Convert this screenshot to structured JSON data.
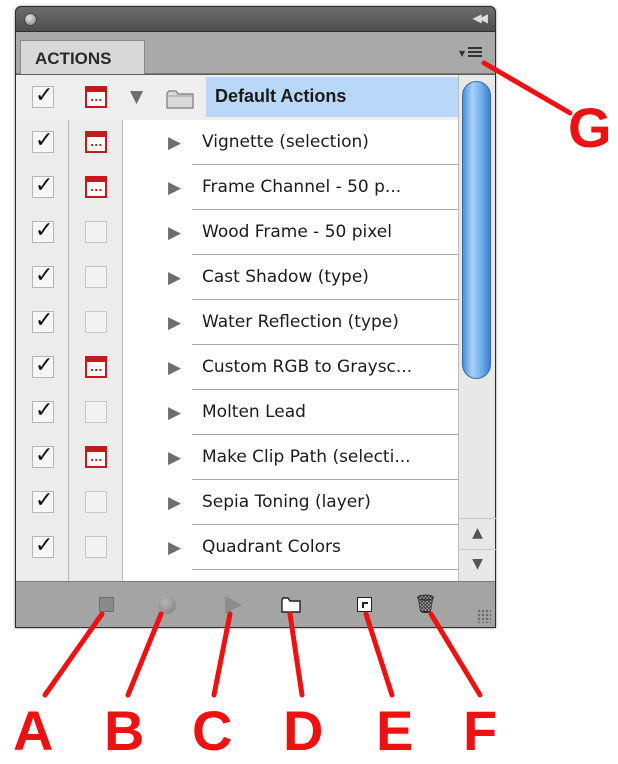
{
  "panel": {
    "tab_label": "ACTIONS",
    "icons": {
      "window_control": "circle-button-icon",
      "collapse": "double-chevron-left-icon",
      "panel_menu": "panel-menu-icon"
    }
  },
  "actions_list": {
    "set": {
      "name": "Default Actions",
      "checked": true,
      "dialog": true,
      "expanded": true,
      "selected": true
    },
    "items": [
      {
        "name": "Vignette (selection)",
        "checked": true,
        "dialog": true
      },
      {
        "name": "Frame Channel - 50 p...",
        "checked": true,
        "dialog": true
      },
      {
        "name": "Wood Frame - 50 pixel",
        "checked": true,
        "dialog": false
      },
      {
        "name": "Cast Shadow (type)",
        "checked": true,
        "dialog": false
      },
      {
        "name": "Water Reflection (type)",
        "checked": true,
        "dialog": false
      },
      {
        "name": "Custom RGB to Graysc...",
        "checked": true,
        "dialog": true
      },
      {
        "name": "Molten Lead",
        "checked": true,
        "dialog": false
      },
      {
        "name": "Make Clip Path (selecti...",
        "checked": true,
        "dialog": true
      },
      {
        "name": "Sepia Toning (layer)",
        "checked": true,
        "dialog": false
      },
      {
        "name": "Quadrant Colors",
        "checked": true,
        "dialog": false
      }
    ]
  },
  "bottom_bar": {
    "buttons": [
      {
        "id": "stop",
        "icon": "stop-square-icon"
      },
      {
        "id": "record",
        "icon": "record-circle-icon"
      },
      {
        "id": "play",
        "icon": "play-triangle-icon"
      },
      {
        "id": "new_set",
        "icon": "folder-icon"
      },
      {
        "id": "new_action",
        "icon": "new-item-icon"
      },
      {
        "id": "delete",
        "icon": "trash-icon"
      }
    ]
  },
  "callouts": {
    "A": "A",
    "B": "B",
    "C": "C",
    "D": "D",
    "E": "E",
    "F": "F",
    "G": "G",
    "color": "#ee1111"
  }
}
